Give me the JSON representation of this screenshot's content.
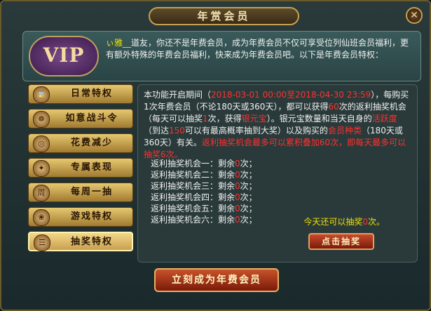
{
  "window": {
    "title": "年赏会员",
    "close": "✕"
  },
  "header": {
    "badge": "VIP",
    "name": "ぃ雅__",
    "intro": "道友，你还不是年费会员，成为年费会员不仅可享受位列仙班会员福利，更有额外特殊的年费会员福利，快来成为年费会员吧。以下是年费会员特权："
  },
  "sidebar": {
    "items": [
      {
        "label": "日常特权",
        "icon": "⌛",
        "icon_name": "hourglass-icon",
        "active": false
      },
      {
        "label": "如意战斗令",
        "icon": "☸",
        "icon_name": "mask-icon",
        "active": false
      },
      {
        "label": "花费减少",
        "icon": "◎",
        "icon_name": "ingot-icon",
        "active": false
      },
      {
        "label": "专属表现",
        "icon": "✦",
        "icon_name": "aura-icon",
        "active": false
      },
      {
        "label": "每周一抽",
        "icon": "周",
        "icon_name": "weekly-icon",
        "active": false
      },
      {
        "label": "游戏特权",
        "icon": "❀",
        "icon_name": "game-icon",
        "active": false
      },
      {
        "label": "抽奖特权",
        "icon": "☰",
        "icon_name": "scroll-icon",
        "active": true
      }
    ]
  },
  "content": {
    "p1": "本功能开启期间（",
    "period": "2018-03-01 00:00至2018-04-30 23:59",
    "p2": "），每购买1次年费会员（不论180天或360天），都可以获得",
    "chances": "60",
    "p3": "次的返利抽奖机会（每天可以抽奖",
    "daily": "1",
    "p4": "次，获得",
    "reward": "银元宝",
    "p5": "）。银元宝数量和当天自身的",
    "activity": "活跃度",
    "p6": "（到达",
    "activity_value": "150",
    "p7": "可以有最高概率抽到大奖）以及购买的",
    "member_type": "会员种类",
    "p8": "（180天或360天）有关。",
    "warning": "返利抽奖机会最多可以累积叠加60次，即每天最多可以抽奖6次。",
    "lottery": [
      {
        "name": "返利抽奖机会一",
        "count": "0"
      },
      {
        "name": "返利抽奖机会二",
        "count": "0"
      },
      {
        "name": "返利抽奖机会三",
        "count": "0"
      },
      {
        "name": "返利抽奖机会四",
        "count": "0"
      },
      {
        "name": "返利抽奖机会五",
        "count": "0"
      },
      {
        "name": "返利抽奖机会六",
        "count": "0"
      }
    ],
    "remain_label": "：剩余",
    "times_label": "次；",
    "today_prefix": "今天还可以抽奖",
    "today_count": "0",
    "today_suffix": "次。",
    "draw_button": "点击抽奖"
  },
  "footer": {
    "join_button": "立刻成为年费会员"
  }
}
